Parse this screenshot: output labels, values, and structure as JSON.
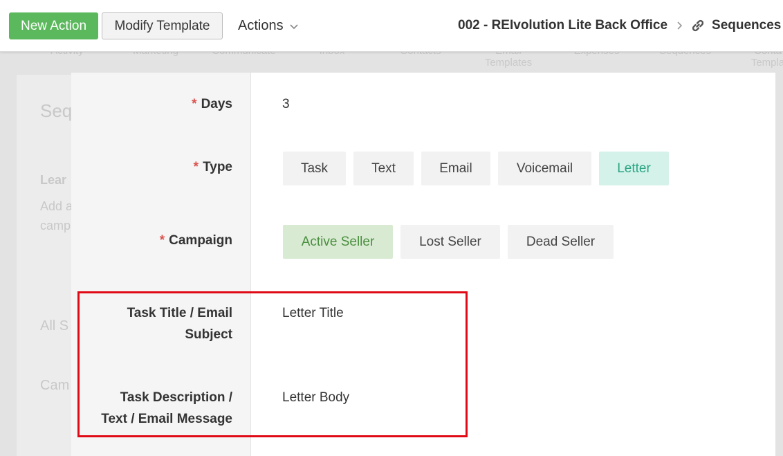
{
  "toolbar": {
    "new_action": "New Action",
    "modify_template": "Modify Template",
    "actions": "Actions",
    "breadcrumb_account": "002 - REIvolution Lite Back Office",
    "breadcrumb_current": "Sequences"
  },
  "background": {
    "nav_items": [
      "Activity",
      "Marketing",
      "Communicate",
      "Inbox",
      "Contacts",
      "Email\nTemplates",
      "Expenses",
      "Sequences",
      "Conta\nTempla"
    ],
    "fragments": [
      "Seq",
      "Lear",
      "Add a",
      "camp",
      "All S",
      "Cam"
    ]
  },
  "form": {
    "days": {
      "label": "Days",
      "required": "*",
      "value": "3"
    },
    "type": {
      "label": "Type",
      "required": "*",
      "options": [
        "Task",
        "Text",
        "Email",
        "Voicemail",
        "Letter"
      ],
      "selected": "Letter"
    },
    "campaign": {
      "label": "Campaign",
      "required": "*",
      "options": [
        "Active Seller",
        "Lost Seller",
        "Dead Seller"
      ],
      "selected": "Active Seller"
    },
    "task_title": {
      "label_line1": "Task Title / Email",
      "label_line2": "Subject",
      "value": "Letter Title"
    },
    "task_description": {
      "label_line1": "Task Description /",
      "label_line2": "Text / Email Message",
      "value": "Letter Body"
    }
  },
  "colors": {
    "new_action_bg": "#5cb85c",
    "selected_type_bg": "#d4f2ea",
    "selected_type_text": "#2aa583",
    "selected_campaign_bg": "#d9ead3",
    "selected_campaign_text": "#4a8f3f",
    "required_marker": "#d9534f",
    "highlight_border": "#e00a16"
  }
}
